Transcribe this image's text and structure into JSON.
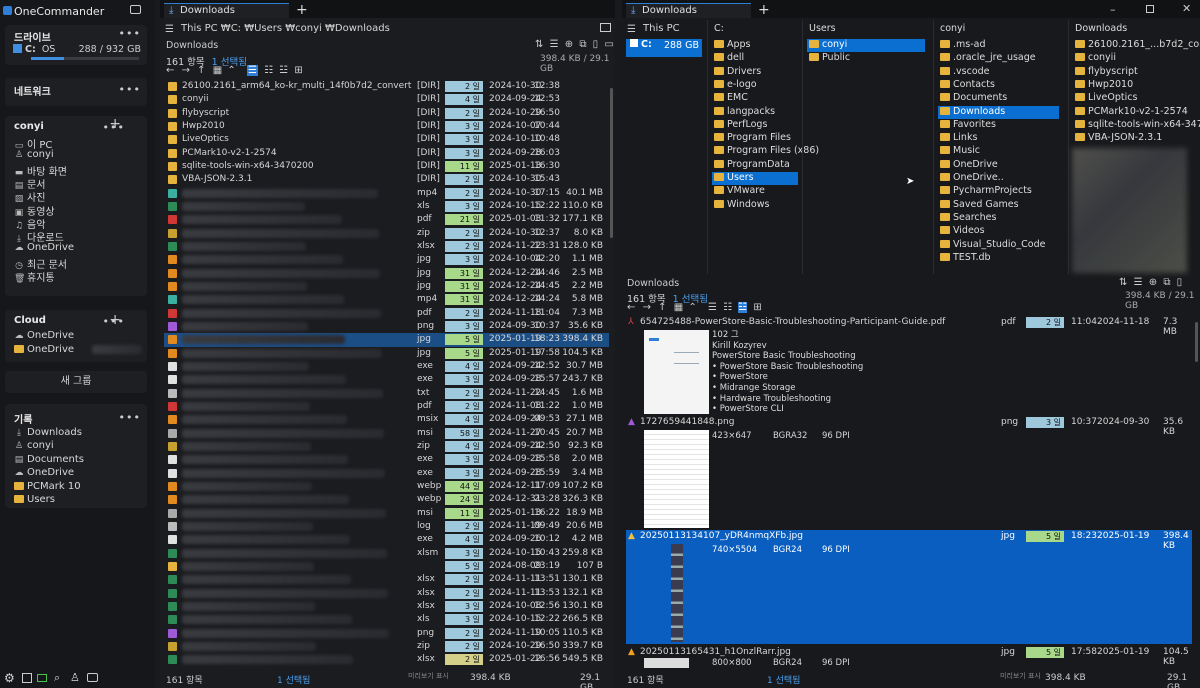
{
  "app": {
    "title": "OneCommander"
  },
  "sidebar": {
    "drives_title": "드라이브",
    "drive": {
      "letter": "C:",
      "name": "OS",
      "usage": "288 / 932 GB",
      "fill": 0.31
    },
    "network_title": "네트워크",
    "user_title": "conyi",
    "user_items": [
      {
        "icon": "pc-icon",
        "label": "이 PC"
      },
      {
        "icon": "user-icon",
        "label": "conyi"
      },
      {
        "icon": "desktop-icon",
        "label": "바탕 화면"
      },
      {
        "icon": "document-icon",
        "label": "문서"
      },
      {
        "icon": "picture-icon",
        "label": "사진"
      },
      {
        "icon": "video-icon",
        "label": "동영상"
      },
      {
        "icon": "music-icon",
        "label": "음악"
      },
      {
        "icon": "download-icon",
        "label": "다운로드"
      },
      {
        "icon": "cloud-icon",
        "label": "OneDrive"
      },
      {
        "icon": "clock-icon",
        "label": "최근 문서"
      },
      {
        "icon": "trash-icon",
        "label": "휴지통"
      }
    ],
    "cloud_title": "Cloud",
    "cloud_items": [
      {
        "label": "OneDrive"
      },
      {
        "label": "OneDrive"
      }
    ],
    "new_group": "새 그룹",
    "history_title": "기록",
    "history_items": [
      {
        "icon": "download-icon",
        "label": "Downloads"
      },
      {
        "icon": "user-icon",
        "label": "conyi"
      },
      {
        "icon": "document-icon",
        "label": "Documents"
      },
      {
        "icon": "cloud-icon",
        "label": "OneDrive"
      },
      {
        "icon": "folder-icon",
        "label": "PCMark 10"
      },
      {
        "icon": "folder-icon",
        "label": "Users"
      }
    ]
  },
  "left_pane": {
    "tab": "Downloads",
    "path": "This PC  ₩C:  ₩Users  ₩conyi  ₩Downloads",
    "title": "Downloads",
    "count": "161 항목",
    "selected": "1 선택됨",
    "size": "398.4 KB / 29.1 GB",
    "rows": [
      {
        "name": "26100.2161_arm64_ko-kr_multi_14f0b7d2_convert",
        "type": "[DIR]",
        "age": "2 일",
        "color": "#9ec9dd",
        "date": "2024-10-30",
        "time": "12:38",
        "size": ""
      },
      {
        "name": "conyii",
        "type": "[DIR]",
        "age": "4 일",
        "color": "#9ec9dd",
        "date": "2024-09-24",
        "time": "12:53",
        "size": ""
      },
      {
        "name": "flybyscript",
        "type": "[DIR]",
        "age": "2 일",
        "color": "#9ec9dd",
        "date": "2024-10-29",
        "time": "16:50",
        "size": ""
      },
      {
        "name": "Hwp2010",
        "type": "[DIR]",
        "age": "3 일",
        "color": "#9ec9dd",
        "date": "2024-10-07",
        "time": "10:44",
        "size": ""
      },
      {
        "name": "LiveOptics",
        "type": "[DIR]",
        "age": "3 일",
        "color": "#9ec9dd",
        "date": "2024-10-10",
        "time": "10:48",
        "size": ""
      },
      {
        "name": "PCMark10-v2-1-2574",
        "type": "[DIR]",
        "age": "3 일",
        "color": "#9ec9dd",
        "date": "2024-09-28",
        "time": "16:03",
        "size": ""
      },
      {
        "name": "sqlite-tools-win-x64-3470200",
        "type": "[DIR]",
        "age": "11 일",
        "color": "#a8d98a",
        "date": "2025-01-13",
        "time": "16:30",
        "size": ""
      },
      {
        "name": "VBA-JSON-2.3.1",
        "type": "[DIR]",
        "age": "2 일",
        "color": "#9ec9dd",
        "date": "2024-10-30",
        "time": "15:43",
        "size": ""
      },
      {
        "name": "",
        "type": "mp4",
        "age": "2 일",
        "color": "#9ec9dd",
        "date": "2024-10-30",
        "time": "17:15",
        "size": "40.1 MB"
      },
      {
        "name": "",
        "type": "xls",
        "age": "3 일",
        "color": "#9ec9dd",
        "date": "2024-10-15",
        "time": "12:22",
        "size": "110.0 KB"
      },
      {
        "name": "",
        "type": "pdf",
        "age": "21 일",
        "color": "#a8d98a",
        "date": "2025-01-03",
        "time": "11:32",
        "size": "177.1 KB"
      },
      {
        "name": "",
        "type": "zip",
        "age": "2 일",
        "color": "#9ec9dd",
        "date": "2024-10-30",
        "time": "12:37",
        "size": "8.0 KB"
      },
      {
        "name": "",
        "type": "xlsx",
        "age": "2 일",
        "color": "#9ec9dd",
        "date": "2024-11-22",
        "time": "13:31",
        "size": "128.0 KB"
      },
      {
        "name": "",
        "type": "jpg",
        "age": "3 일",
        "color": "#9ec9dd",
        "date": "2024-10-04",
        "time": "12:20",
        "size": "1.1 MB"
      },
      {
        "name": "",
        "type": "jpg",
        "age": "31 일",
        "color": "#a8d98a",
        "date": "2024-12-24",
        "time": "14:46",
        "size": "2.5 MB"
      },
      {
        "name": "",
        "type": "jpg",
        "age": "31 일",
        "color": "#a8d98a",
        "date": "2024-12-24",
        "time": "14:45",
        "size": "2.2 MB"
      },
      {
        "name": "",
        "type": "mp4",
        "age": "31 일",
        "color": "#a8d98a",
        "date": "2024-12-24",
        "time": "14:24",
        "size": "5.8 MB"
      },
      {
        "name": "",
        "type": "pdf",
        "age": "2 일",
        "color": "#9ec9dd",
        "date": "2024-11-18",
        "time": "11:04",
        "size": "7.3 MB"
      },
      {
        "name": "",
        "type": "png",
        "age": "3 일",
        "color": "#9ec9dd",
        "date": "2024-09-30",
        "time": "10:37",
        "size": "35.6 KB"
      },
      {
        "name": "",
        "type": "jpg",
        "age": "5 일",
        "color": "#a8d98a",
        "date": "2025-01-19",
        "time": "18:23",
        "size": "398.4 KB",
        "selected": true
      },
      {
        "name": "",
        "type": "jpg",
        "age": "5 일",
        "color": "#a8d98a",
        "date": "2025-01-19",
        "time": "17:58",
        "size": "104.5 KB"
      },
      {
        "name": "",
        "type": "exe",
        "age": "4 일",
        "color": "#9ec9dd",
        "date": "2024-09-24",
        "time": "12:52",
        "size": "30.7 MB"
      },
      {
        "name": "",
        "type": "exe",
        "age": "3 일",
        "color": "#9ec9dd",
        "date": "2024-09-28",
        "time": "15:57",
        "size": "243.7 KB"
      },
      {
        "name": "",
        "type": "txt",
        "age": "2 일",
        "color": "#9ec9dd",
        "date": "2024-11-22",
        "time": "14:45",
        "size": "1.6 MB"
      },
      {
        "name": "",
        "type": "pdf",
        "age": "2 일",
        "color": "#9ec9dd",
        "date": "2024-11-08",
        "time": "11:22",
        "size": "1.0 MB"
      },
      {
        "name": "",
        "type": "msix",
        "age": "4 일",
        "color": "#9ec9dd",
        "date": "2024-09-24",
        "time": "09:53",
        "size": "27.1 MB"
      },
      {
        "name": "",
        "type": "msi",
        "age": "58 일",
        "color": "#9ec9dd",
        "date": "2024-11-27",
        "time": "10:45",
        "size": "20.7 MB"
      },
      {
        "name": "",
        "type": "zip",
        "age": "4 일",
        "color": "#9ec9dd",
        "date": "2024-09-24",
        "time": "12:50",
        "size": "92.3 KB"
      },
      {
        "name": "",
        "type": "exe",
        "age": "3 일",
        "color": "#9ec9dd",
        "date": "2024-09-28",
        "time": "15:58",
        "size": "2.0 MB"
      },
      {
        "name": "",
        "type": "exe",
        "age": "3 일",
        "color": "#9ec9dd",
        "date": "2024-09-28",
        "time": "15:59",
        "size": "3.4 MB"
      },
      {
        "name": "",
        "type": "webp",
        "age": "44 일",
        "color": "#a8d98a",
        "date": "2024-12-11",
        "time": "17:09",
        "size": "107.2 KB"
      },
      {
        "name": "",
        "type": "webp",
        "age": "24 일",
        "color": "#a8d98a",
        "date": "2024-12-31",
        "time": "23:28",
        "size": "326.3 KB"
      },
      {
        "name": "",
        "type": "msi",
        "age": "11 일",
        "color": "#a8d98a",
        "date": "2025-01-13",
        "time": "16:22",
        "size": "18.9 MB"
      },
      {
        "name": "",
        "type": "log",
        "age": "2 일",
        "color": "#9ec9dd",
        "date": "2024-11-19",
        "time": "09:49",
        "size": "20.6 MB"
      },
      {
        "name": "",
        "type": "exe",
        "age": "4 일",
        "color": "#9ec9dd",
        "date": "2024-09-26",
        "time": "10:12",
        "size": "4.2 MB"
      },
      {
        "name": "",
        "type": "xlsm",
        "age": "3 일",
        "color": "#9ec9dd",
        "date": "2024-10-15",
        "time": "10:43",
        "size": "259.8 KB"
      },
      {
        "name": "",
        "type": "",
        "age": "5 일",
        "color": "#9ec9dd",
        "date": "2024-08-09",
        "time": "23:19",
        "size": "107 B"
      },
      {
        "name": "",
        "type": "xlsx",
        "age": "2 일",
        "color": "#9ec9dd",
        "date": "2024-11-11",
        "time": "13:51",
        "size": "130.1 KB"
      },
      {
        "name": "",
        "type": "xlsx",
        "age": "2 일",
        "color": "#9ec9dd",
        "date": "2024-11-11",
        "time": "13:53",
        "size": "132.1 KB"
      },
      {
        "name": "",
        "type": "xlsx",
        "age": "3 일",
        "color": "#9ec9dd",
        "date": "2024-10-08",
        "time": "12:56",
        "size": "130.1 KB"
      },
      {
        "name": "",
        "type": "xls",
        "age": "3 일",
        "color": "#9ec9dd",
        "date": "2024-10-15",
        "time": "12:22",
        "size": "266.5 KB"
      },
      {
        "name": "",
        "type": "png",
        "age": "2 일",
        "color": "#9ec9dd",
        "date": "2024-11-19",
        "time": "10:05",
        "size": "110.5 KB"
      },
      {
        "name": "",
        "type": "zip",
        "age": "2 일",
        "color": "#9ec9dd",
        "date": "2024-10-29",
        "time": "16:50",
        "size": "339.7 KB"
      },
      {
        "name": "",
        "type": "xlsx",
        "age": "2 일",
        "color": "#d4d08a",
        "date": "2025-01-22",
        "time": "16:56",
        "size": "549.5 KB"
      }
    ],
    "status": {
      "count": "161 항목",
      "selected": "1 선택됨",
      "hint": "미리보기 표시",
      "size": "398.4 KB",
      "total": "29.1 GB"
    }
  },
  "right_pane": {
    "tab": "Downloads",
    "path": "This PC",
    "col0": {
      "items": [
        {
          "label": "C:",
          "size": "288 GB",
          "selected": true
        }
      ]
    },
    "col1": {
      "head": "C:",
      "items": [
        "Apps",
        "dell",
        "Drivers",
        "e-logo",
        "EMC",
        "langpacks",
        "PerfLogs",
        "Program Files",
        "Program Files (x86)",
        "ProgramData",
        "Users",
        "VMware",
        "Windows"
      ],
      "selected": 10
    },
    "col2": {
      "head": "Users",
      "items": [
        "conyi",
        "Public"
      ],
      "selected": 0
    },
    "col3": {
      "head": "conyi",
      "items": [
        ".ms-ad",
        ".oracle_jre_usage",
        ".vscode",
        "Contacts",
        "Documents",
        "Downloads",
        "Favorites",
        "Links",
        "Music",
        "OneDrive",
        "OneDrive..",
        "PycharmProjects",
        "Saved Games",
        "Searches",
        "Videos",
        "Visual_Studio_Code",
        "TEST.db"
      ],
      "selected": 5
    },
    "col4": {
      "head": "Downloads",
      "items": [
        "26100.2161_...b7d2_convert",
        "conyii",
        "flybyscript",
        "Hwp2010",
        "LiveOptics",
        "PCMark10-v2-1-2574",
        "sqlite-tools-win-x64-3470200",
        "VBA-JSON-2.3.1"
      ]
    },
    "detail": {
      "title": "Downloads",
      "count": "161 항목",
      "selected": "1 선택됨",
      "size": "398.4 KB / 29.1 GB",
      "items": [
        {
          "name": "654725488-PowerStore-Basic-Troubleshooting-Participant-Guide.pdf",
          "type": "pdf",
          "age": "2 일",
          "time": "11:04",
          "date": "2024-11-18",
          "size": "7.3 MB",
          "meta": [
            "102 그",
            "Kirill Kozyrev",
            "PowerStore Basic Troubleshooting",
            "• PowerStore Basic Troubleshooting",
            "• PowerStore",
            "• Midrange Storage",
            "• Hardware Troubleshooting",
            "• PowerStore CLI"
          ]
        },
        {
          "name": "1727659441848.png",
          "type": "png",
          "age": "3 일",
          "time": "10:37",
          "date": "2024-09-30",
          "size": "35.6 KB",
          "dims": "423×647",
          "fmt": "BGRA32",
          "dpi": "96 DPI"
        },
        {
          "name": "20250113134107_yDR4nmqXFb.jpg",
          "type": "jpg",
          "age": "5 일",
          "time": "18:23",
          "date": "2025-01-19",
          "size": "398.4 KB",
          "dims": "740×5504",
          "fmt": "BGR24",
          "dpi": "96 DPI",
          "selected": true
        },
        {
          "name": "20250113165431_h1OnzlRarr.jpg",
          "type": "jpg",
          "age": "5 일",
          "time": "17:58",
          "date": "2025-01-19",
          "size": "104.5 KB",
          "dims": "800×800",
          "fmt": "BGR24",
          "dpi": "96 DPI"
        }
      ]
    },
    "status": {
      "count": "161 항목",
      "selected": "1 선택됨",
      "hint": "미리보기 표시",
      "size": "398.4 KB",
      "total": "29.1 GB"
    }
  },
  "bottom_icons": [
    "settings-icon",
    "panel-icon",
    "battery-icon",
    "search-icon",
    "person-icon",
    "window-icon"
  ]
}
